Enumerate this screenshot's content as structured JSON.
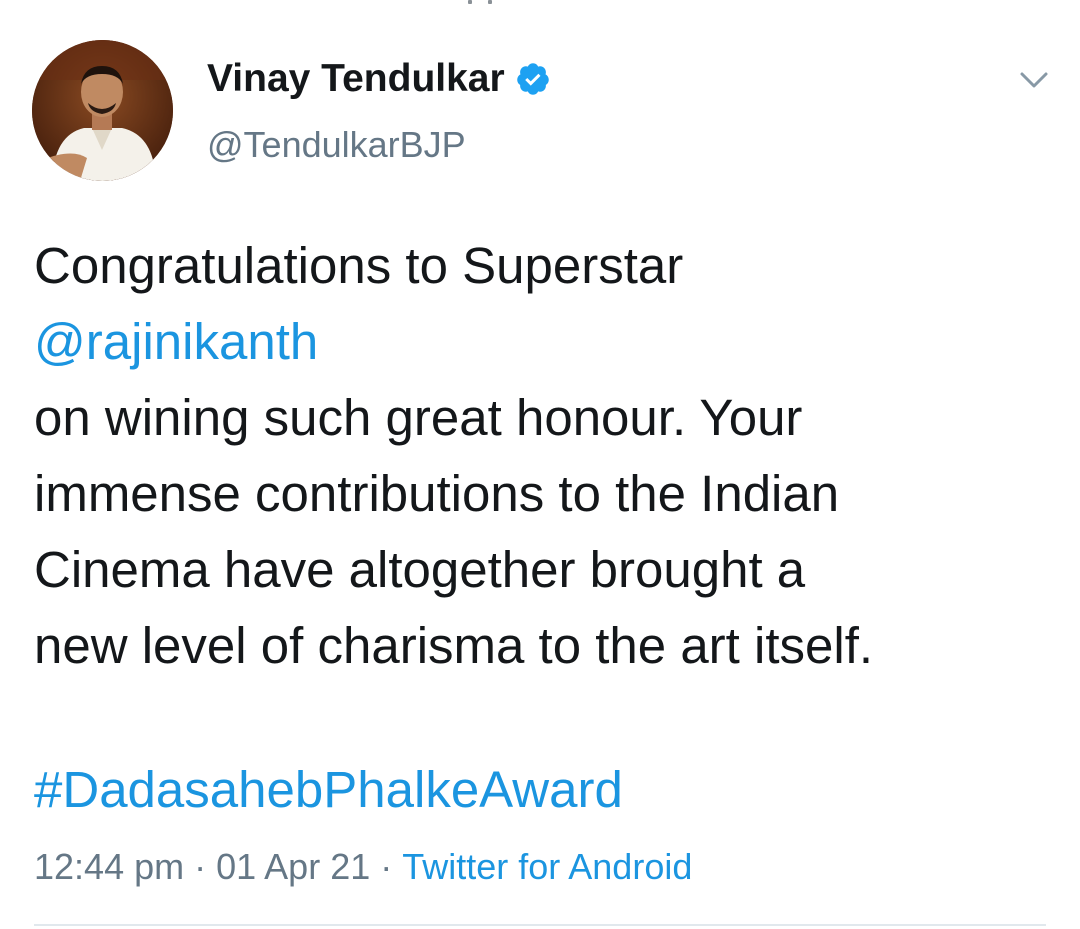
{
  "tweet": {
    "author": {
      "display_name": "Vinay Tendulkar",
      "handle": "@TendulkarBJP",
      "verified": true,
      "avatar_icon": "profile-photo"
    },
    "body": {
      "line1": "Congratulations to Superstar",
      "mention": "@rajinikanth",
      "line3": "on wining such great honour. Your",
      "line4": "immense contributions to the Indian",
      "line5": "Cinema have altogether brought a",
      "line6": "new level of charisma to the art itself."
    },
    "hashtag": "#DadasahebPhalkeAward",
    "meta": {
      "time": "12:44 pm",
      "separator": "·",
      "date": "01 Apr 21",
      "source": "Twitter for Android"
    }
  },
  "icons": {
    "verified": "verified-badge-icon",
    "menu": "chevron-down-icon"
  },
  "colors": {
    "link": "#1b95e0",
    "text": "#14171a",
    "secondary": "#657786",
    "divider": "#e1e8ed"
  }
}
